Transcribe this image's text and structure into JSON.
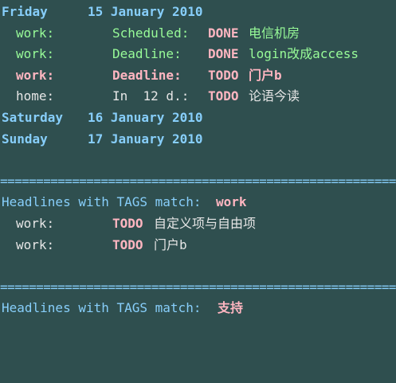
{
  "colors": {
    "background": "#2f4f4f",
    "date_heading": "#87cefa",
    "category_scheduled": "#98fb98",
    "todo_keyword": "#ffb6c1",
    "default_text": "#e6e6e6"
  },
  "agenda": {
    "days": [
      {
        "weekday": "Friday",
        "date": "15 January 2010",
        "entries": [
          {
            "category": "work:",
            "when": "Scheduled:",
            "keyword": "DONE",
            "text": "电信机房"
          },
          {
            "category": "work:",
            "when": "Deadline:",
            "keyword": "DONE",
            "text": "login改成access"
          },
          {
            "category": "work:",
            "when": "Deadline:",
            "keyword": "TODO",
            "text": "门户b"
          },
          {
            "category": "home:",
            "when": "In  12 d.:",
            "keyword": "TODO",
            "text": "论语今读"
          }
        ]
      },
      {
        "weekday": "Saturday",
        "date": "16 January 2010",
        "entries": []
      },
      {
        "weekday": "Sunday",
        "date": "17 January 2010",
        "entries": []
      }
    ]
  },
  "separator": "======================================================================",
  "tag_searches": [
    {
      "prefix": "Headlines with TAGS match:",
      "tag": "work",
      "entries": [
        {
          "category": "work:",
          "keyword": "TODO",
          "text": "自定义项与自由项"
        },
        {
          "category": "work:",
          "keyword": "TODO",
          "text": "门户b"
        }
      ]
    },
    {
      "prefix": "Headlines with TAGS match:",
      "tag": "支持",
      "entries": []
    }
  ]
}
